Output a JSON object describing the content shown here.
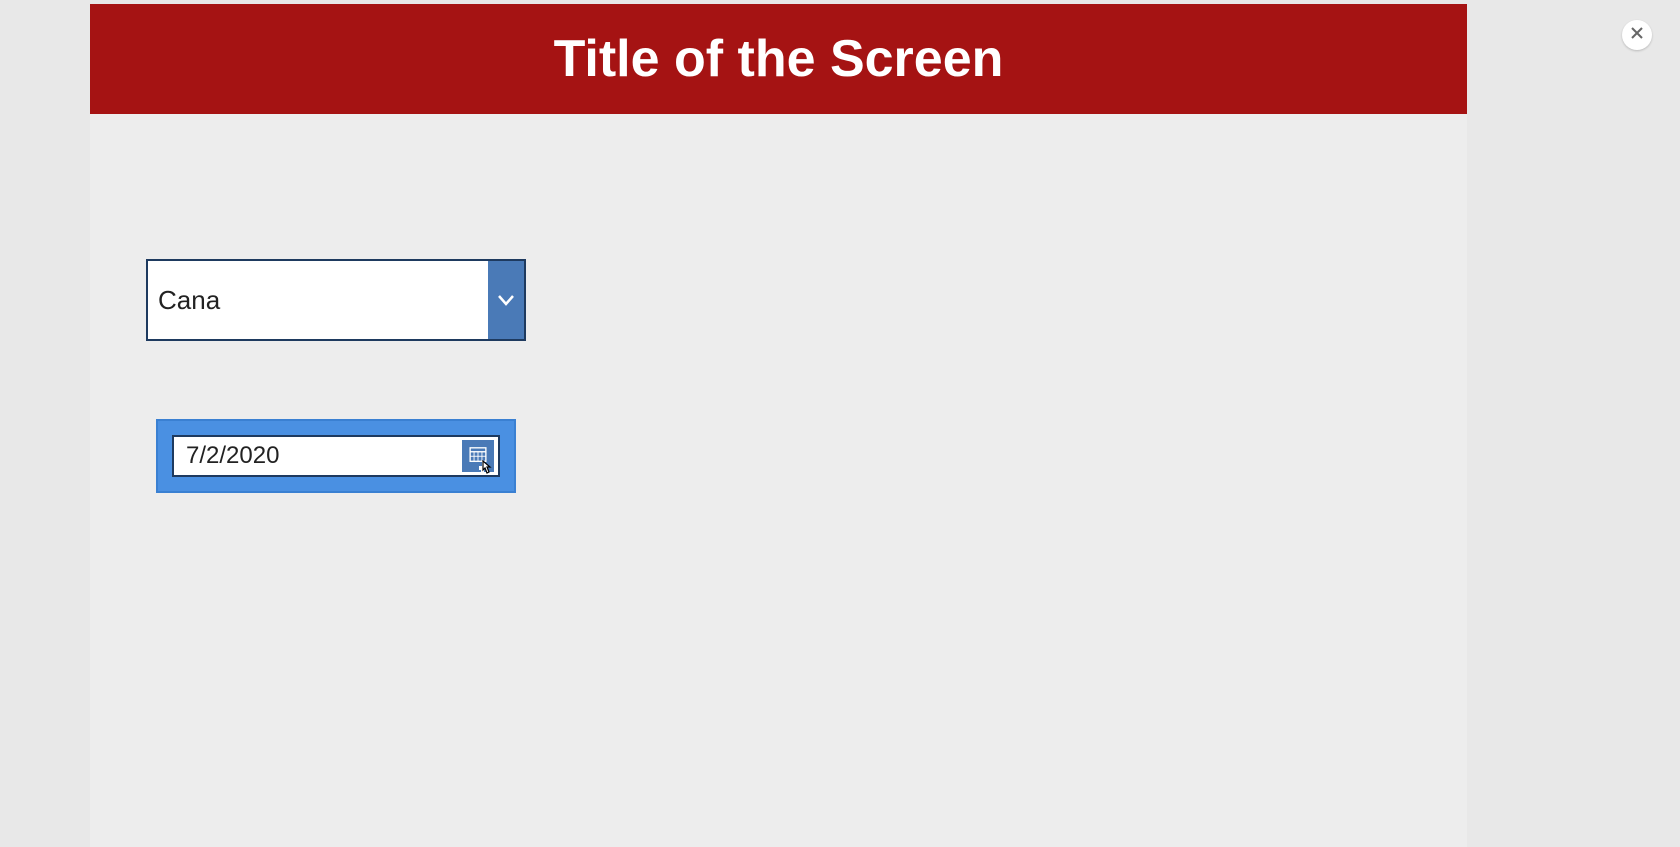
{
  "header": {
    "title": "Title of the Screen"
  },
  "combo": {
    "value": "Cana",
    "icon_name": "chevron-down"
  },
  "date_picker": {
    "value": "7/2/2020",
    "icon_name": "calendar"
  },
  "close": {
    "icon_name": "close-x"
  },
  "colors": {
    "header_bg": "#a51313",
    "accent_blue": "#4a7ab7",
    "selection_blue": "#4a90e2",
    "page_bg": "#e8e8e8"
  }
}
